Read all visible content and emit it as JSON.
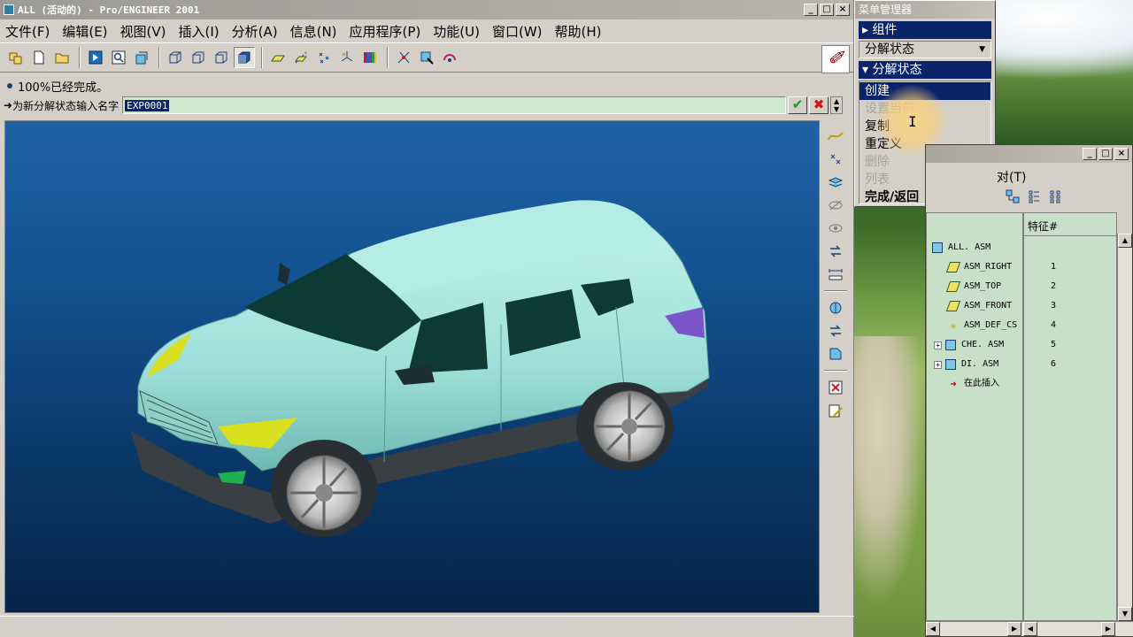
{
  "window": {
    "title": "ALL (活动的) - Pro/ENGINEER 2001",
    "min": "_",
    "max": "□",
    "close": "×"
  },
  "menubar": [
    "文件(F)",
    "编辑(E)",
    "视图(V)",
    "插入(I)",
    "分析(A)",
    "信息(N)",
    "应用程序(P)",
    "功能(U)",
    "窗口(W)",
    "帮助(H)"
  ],
  "message": {
    "line1": "100%已经完成。",
    "prompt": "为新分解状态输入名字",
    "input_value": "EXP0001",
    "ok": "✔",
    "cancel": "✖"
  },
  "menu_manager": {
    "title": "菜单管理器",
    "header1": "组件",
    "dropdown": "分解状态",
    "header2": "分解状态",
    "items": [
      {
        "label": "创建",
        "state": "selected"
      },
      {
        "label": "设置当前",
        "state": "disabled"
      },
      {
        "label": "复制",
        "state": "normal"
      },
      {
        "label": "重定义",
        "state": "normal"
      },
      {
        "label": "删除",
        "state": "disabled"
      },
      {
        "label": "列表",
        "state": "disabled"
      },
      {
        "label": "完成/返回",
        "state": "bold"
      }
    ]
  },
  "model_tree": {
    "menu_label": "树(T)",
    "menu_visible": "对(T)",
    "col_header": "特征#",
    "rows": [
      {
        "label": "ALL. ASM",
        "type": "asm",
        "no": ""
      },
      {
        "label": "ASM_RIGHT",
        "type": "plane",
        "no": "1"
      },
      {
        "label": "ASM_TOP",
        "type": "plane",
        "no": "2"
      },
      {
        "label": "ASM_FRONT",
        "type": "plane",
        "no": "3"
      },
      {
        "label": "ASM_DEF_CS",
        "type": "cs",
        "no": "4"
      },
      {
        "label": "CHE. ASM",
        "type": "asm-plus",
        "no": "5"
      },
      {
        "label": "DI. ASM",
        "type": "asm-plus",
        "no": "6"
      },
      {
        "label": "在此插入",
        "type": "insert",
        "no": ""
      }
    ]
  },
  "colors": {
    "viewport_top": "#1e63a6",
    "viewport_bottom": "#062549",
    "car_body": "#a6e8e2",
    "glass": "#0e3a36",
    "headlight": "#d8e020",
    "selection": "#0a246a"
  }
}
